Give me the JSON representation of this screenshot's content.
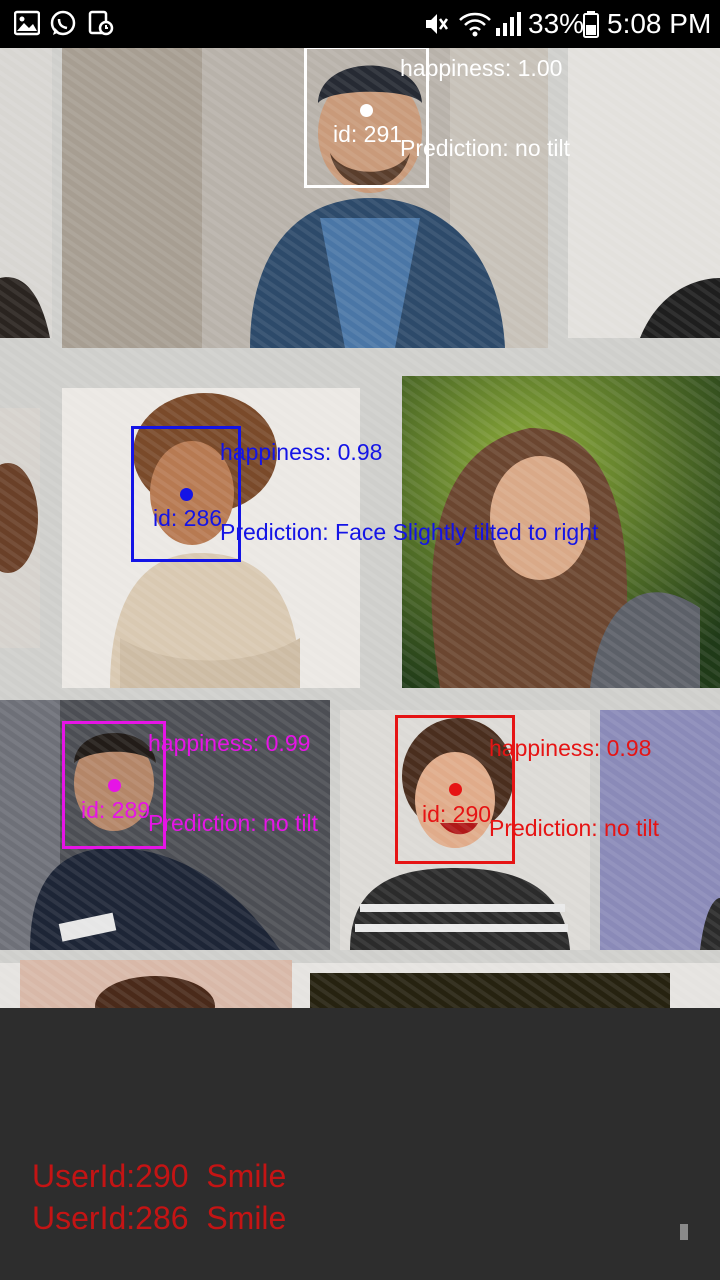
{
  "status_bar": {
    "left_icons": [
      "gallery-icon",
      "whatsapp-icon",
      "screen-record-icon"
    ],
    "right_icons": [
      "mute-icon",
      "wifi-icon",
      "signal-icon",
      "battery-icon"
    ],
    "battery": "33%",
    "time": "5:08 PM"
  },
  "colors": {
    "white": "#ffffff",
    "blue": "#1414e6",
    "magenta": "#e614e6",
    "red": "#e61414",
    "result_text": "#c41414"
  },
  "faces": [
    {
      "id_label": "id: 291",
      "happiness": "happiness: 1.00",
      "prediction": "Prediction: no tilt",
      "color": "#ffffff"
    },
    {
      "id_label": "id: 286",
      "happiness": "happiness: 0.98",
      "prediction": "Prediction: Face Slightly tilted to right",
      "color": "#1414e6"
    },
    {
      "id_label": "id: 289",
      "happiness": "happiness: 0.99",
      "prediction": "Prediction: no tilt",
      "color": "#e614e6"
    },
    {
      "id_label": "id: 290",
      "happiness": "happiness: 0.98",
      "prediction": "Prediction: no tilt",
      "color": "#e61414"
    }
  ],
  "results": [
    "UserId:290  Smile",
    "UserId:286  Smile"
  ]
}
